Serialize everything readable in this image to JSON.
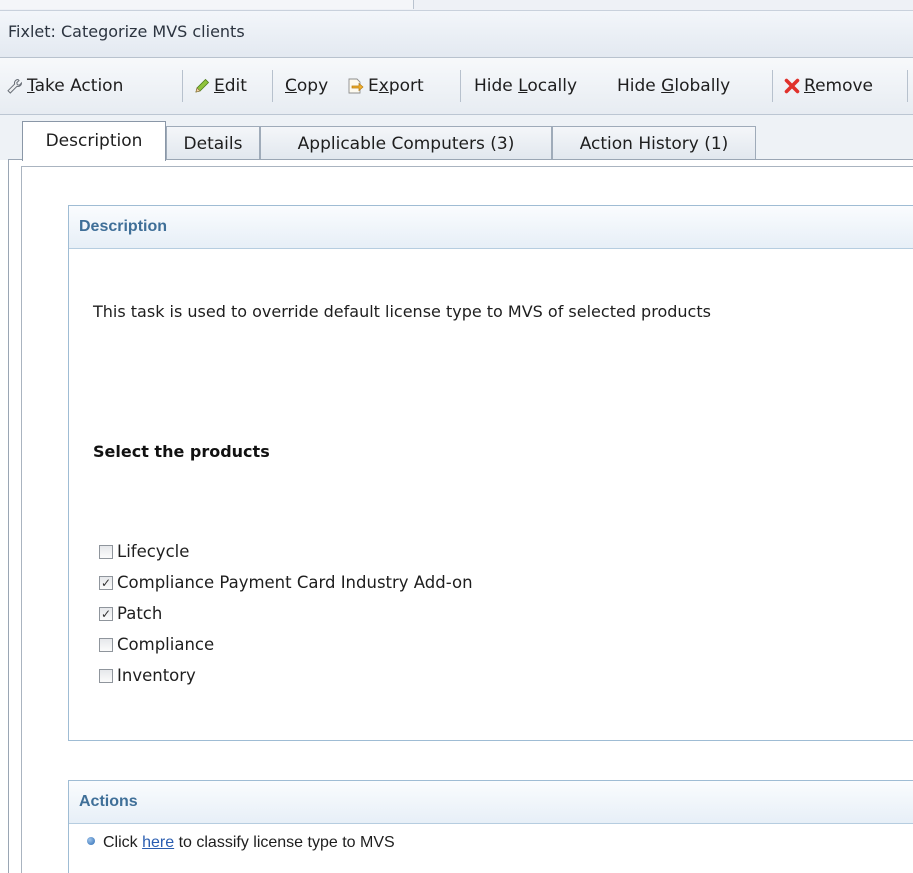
{
  "window": {
    "title": "Fixlet: Categorize MVS clients"
  },
  "toolbar": {
    "take_action": {
      "access_key": "T",
      "rest": "ake Action"
    },
    "edit": {
      "access_key": "E",
      "rest": "dit"
    },
    "copy": {
      "access_key": "C",
      "rest": "opy"
    },
    "export": {
      "pre": "E",
      "access_key": "x",
      "rest": "port"
    },
    "hide_locally": {
      "pre": "Hide ",
      "access_key": "L",
      "rest": "ocally"
    },
    "hide_globally": {
      "pre": "Hide ",
      "access_key": "G",
      "rest": "lobally"
    },
    "remove": {
      "access_key": "R",
      "rest": "emove"
    }
  },
  "tabs": [
    {
      "label": "Description",
      "active": true
    },
    {
      "label": "Details",
      "active": false
    },
    {
      "label": "Applicable Computers (3)",
      "active": false
    },
    {
      "label": "Action History (1)",
      "active": false
    }
  ],
  "description_panel": {
    "header": "Description",
    "text": "This task is used to override default license type to MVS of selected products",
    "select_label": "Select the products",
    "products": [
      {
        "label": "Lifecycle",
        "checked": false
      },
      {
        "label": "Compliance Payment Card Industry Add-on",
        "checked": true
      },
      {
        "label": "Patch",
        "checked": true
      },
      {
        "label": "Compliance",
        "checked": false
      },
      {
        "label": "Inventory",
        "checked": false
      }
    ]
  },
  "actions_panel": {
    "header": "Actions",
    "prefix": "Click ",
    "link": "here",
    "suffix": " to classify license type to MVS"
  },
  "icons": {
    "take_action": "wrench-icon",
    "edit": "pencil-icon",
    "export": "export-icon",
    "remove": "red-x-icon",
    "bullet": "blue-bullet-icon"
  },
  "colors": {
    "panel_header_text": "#3f6f98",
    "link": "#2a5db0",
    "remove_icon": "#e0312b"
  }
}
